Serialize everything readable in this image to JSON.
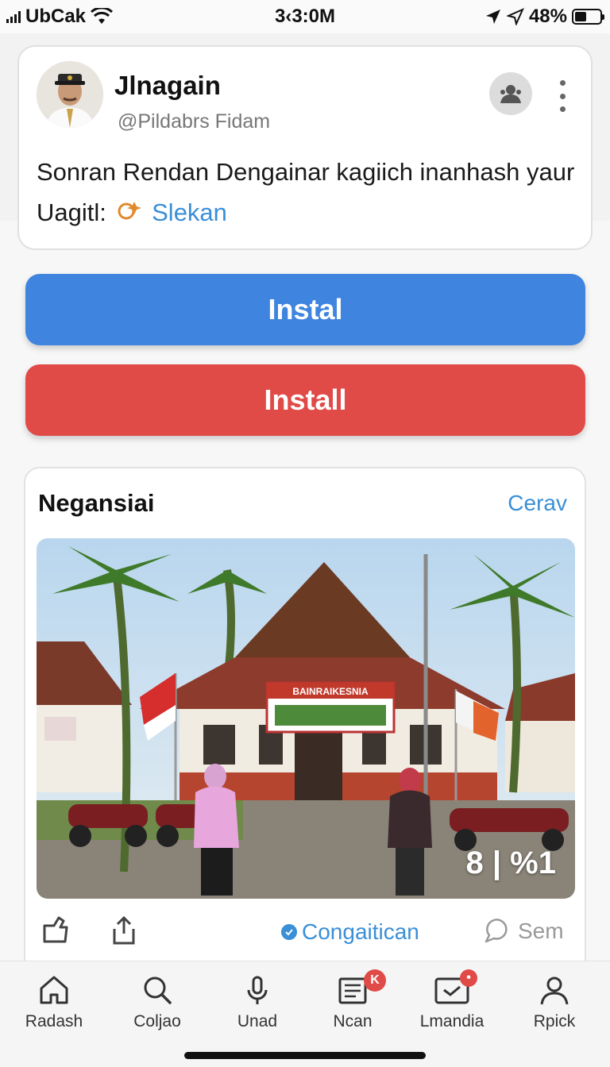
{
  "status_bar": {
    "carrier": "UbCak",
    "time": "3‹3:0M",
    "battery": "48%",
    "battery_level": 0.48
  },
  "post": {
    "author_name": "Jlnagain",
    "author_handle": "@Pildabrs Fidam",
    "text": "Sonran Rendan Dengainar kagiich inanhash yaur Uagitl:",
    "link_text": "Slekan"
  },
  "buttons": {
    "primary_label": "Instal",
    "danger_label": "Install"
  },
  "news": {
    "title": "Negansiai",
    "link_label": "Cerav",
    "banner_text": "BAINRAIKESNIA",
    "image_badge": "8 | %1",
    "verified_label": "Congaitican",
    "see_label": "Sem"
  },
  "tabs": [
    {
      "label": "Radash",
      "icon": "home-icon"
    },
    {
      "label": "Coljao",
      "icon": "search-icon"
    },
    {
      "label": "Unad",
      "icon": "microphone-icon"
    },
    {
      "label": "Ncan",
      "icon": "news-icon",
      "badge": "K"
    },
    {
      "label": "Lmandia",
      "icon": "inbox-icon",
      "badge": "•"
    },
    {
      "label": "Rpick",
      "icon": "profile-icon"
    }
  ],
  "colors": {
    "primary": "#3f85e0",
    "danger": "#e04a47",
    "link": "#3a8fd6"
  }
}
